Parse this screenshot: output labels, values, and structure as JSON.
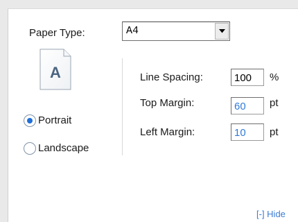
{
  "paper_type": {
    "label": "Paper Type:",
    "value": "A4"
  },
  "orientation": {
    "icon_letter": "A",
    "options": [
      {
        "label": "Portrait",
        "checked": true
      },
      {
        "label": "Landscape",
        "checked": false
      }
    ]
  },
  "line_spacing": {
    "label": "Line Spacing:",
    "value": "100",
    "unit": "%"
  },
  "top_margin": {
    "label": "Top Margin:",
    "value": "60",
    "unit": "pt"
  },
  "left_margin": {
    "label": "Left Margin:",
    "value": "10",
    "unit": "pt"
  },
  "hide_link": "[-] Hide",
  "colors": {
    "accent": "#1f6fd8",
    "link": "#3b7bd4",
    "field_value_blue": "#2f7bd8"
  },
  "icons": [
    "chevron-down-icon",
    "document-icon"
  ]
}
